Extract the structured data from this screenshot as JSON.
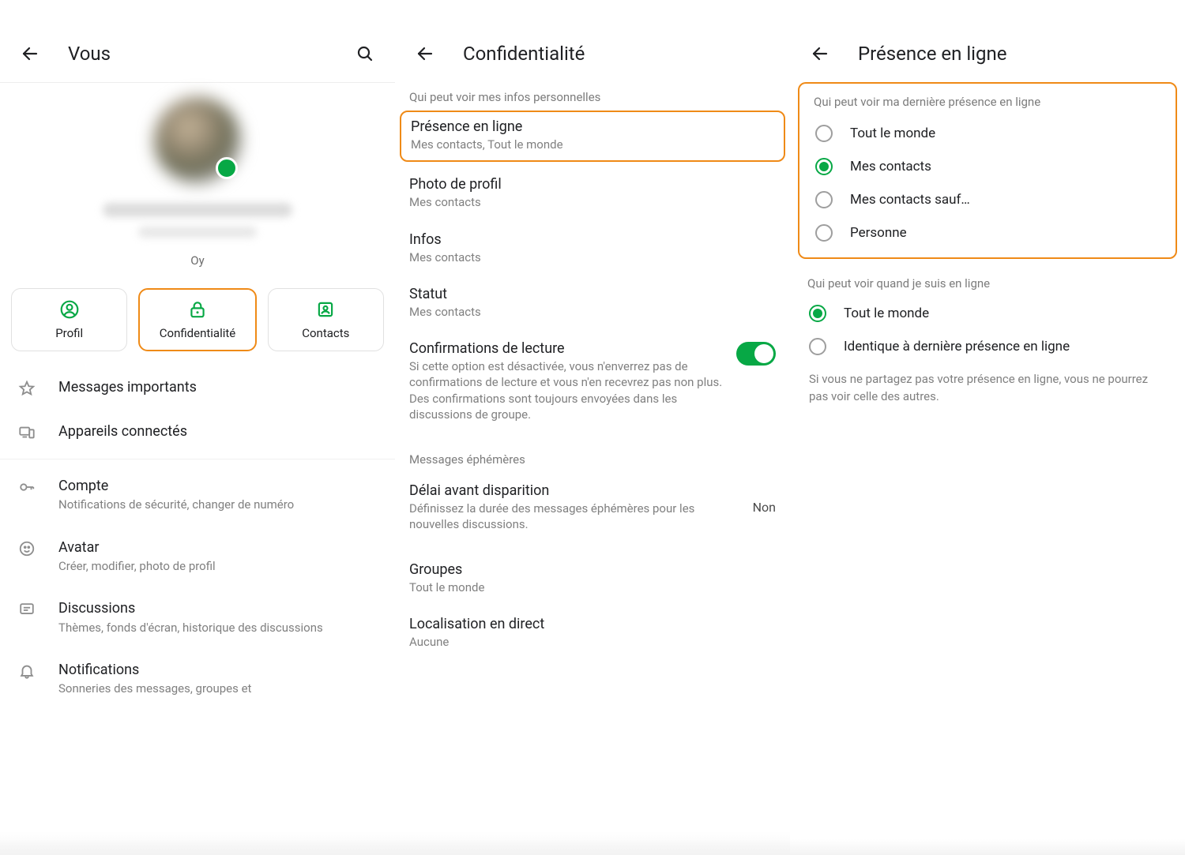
{
  "pane1": {
    "title": "Vous",
    "under_name": "Oy",
    "chips": {
      "profile": "Profil",
      "privacy": "Confidentialité",
      "contacts": "Contacts"
    },
    "menu": {
      "starred": "Messages importants",
      "linked": "Appareils connectés",
      "account_t": "Compte",
      "account_s": "Notifications de sécurité, changer de numéro",
      "avatar_t": "Avatar",
      "avatar_s": "Créer, modifier, photo de profil",
      "chats_t": "Discussions",
      "chats_s": "Thèmes, fonds d'écran, historique des discussions",
      "notif_t": "Notifications",
      "notif_s": "Sonneries des messages, groupes et"
    }
  },
  "pane2": {
    "title": "Confidentialité",
    "section_personal": "Qui peut voir mes infos personnelles",
    "last_seen_t": "Présence en ligne",
    "last_seen_s": "Mes contacts, Tout le monde",
    "photo_t": "Photo de profil",
    "photo_s": "Mes contacts",
    "about_t": "Infos",
    "about_s": "Mes contacts",
    "status_t": "Statut",
    "status_s": "Mes contacts",
    "read_t": "Confirmations de lecture",
    "read_s": "Si cette option est désactivée, vous n'enverrez pas de confirmations de lecture et vous n'en recevrez pas non plus. Des confirmations sont toujours envoyées dans les discussions de groupe.",
    "eph_section": "Messages éphémères",
    "timer_t": "Délai avant disparition",
    "timer_s": "Définissez la durée des messages éphémères pour les nouvelles discussions.",
    "timer_v": "Non",
    "groups_t": "Groupes",
    "groups_s": "Tout le monde",
    "live_t": "Localisation en direct",
    "live_s": "Aucune"
  },
  "pane3": {
    "title": "Présence en ligne",
    "section1": "Qui peut voir ma dernière présence en ligne",
    "opt_everyone": "Tout le monde",
    "opt_contacts": "Mes contacts",
    "opt_except": "Mes contacts sauf…",
    "opt_nobody": "Personne",
    "section2": "Qui peut voir quand je suis en ligne",
    "opt2_everyone": "Tout le monde",
    "opt2_same": "Identique à dernière présence en ligne",
    "note": "Si vous ne partagez pas votre présence en ligne, vous ne pourrez pas voir celle des autres."
  }
}
